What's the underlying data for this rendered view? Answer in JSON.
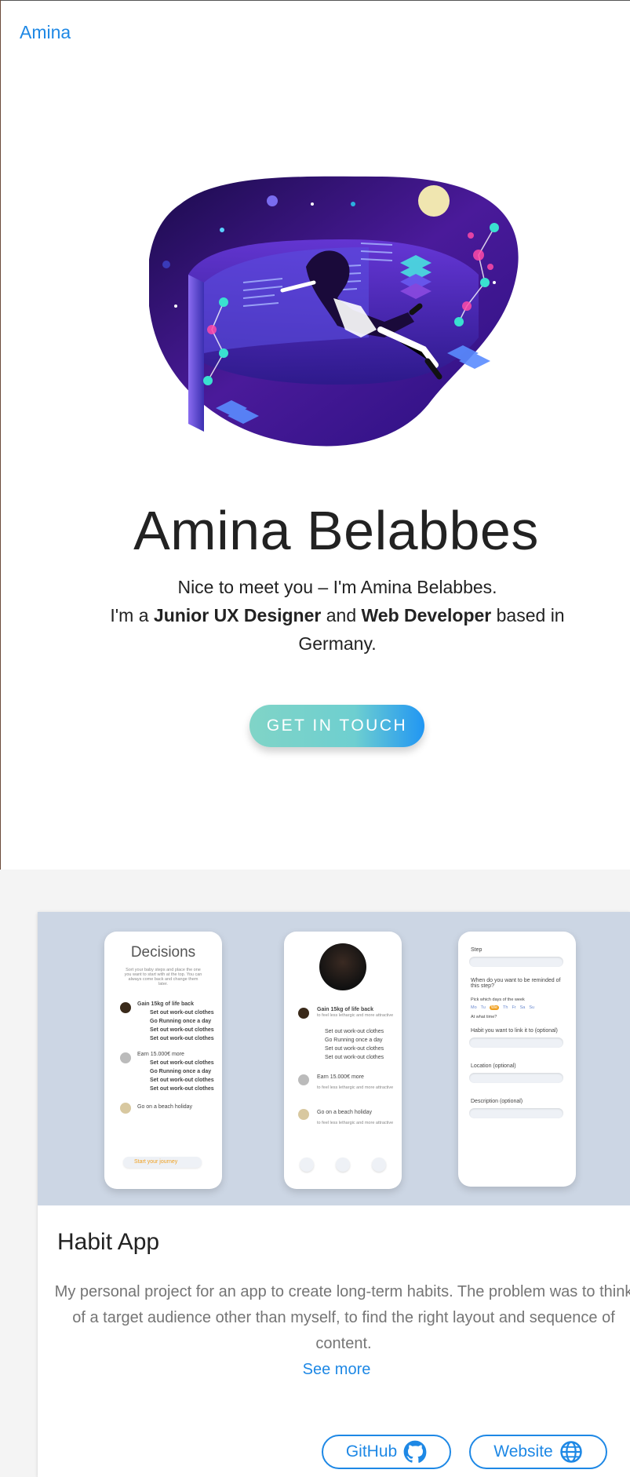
{
  "nav": {
    "brand": "Amina"
  },
  "hero": {
    "name": "Amina Belabbes",
    "intro_line1": "Nice to meet you – I'm Amina Belabbes.",
    "intro_prefix": "I'm a ",
    "role1": "Junior UX Designer",
    "intro_and": " and ",
    "role2": "Web Developer",
    "intro_suffix": " based in Germany.",
    "cta_label": "GET IN TOUCH"
  },
  "project": {
    "title": "Habit App",
    "description": "My personal project for an app to create long-term habits. The problem was to think of a target audience other than myself, to find the right layout and sequence of content.",
    "see_more": "See more",
    "github_label": "GitHub",
    "website_label": "Website",
    "mockups": {
      "screen1": {
        "title": "Decisions",
        "subtitle": "Sort your baby steps and place the one you want to start with at the top. You can always come back and change them later.",
        "goal1": "Gain 15kg of life back",
        "steps": [
          "Set out work-out clothes",
          "Go Running once a day",
          "Set out work-out clothes",
          "Set out work-out clothes"
        ],
        "goal2": "Earn 15.000€ more",
        "goal3": "Go on a beach holiday",
        "button": "Start your journey"
      },
      "screen2": {
        "goal1": "Gain 15kg of life back",
        "goal1_sub": "to feel less lethargic and more attractive",
        "steps": [
          "Set out work-out clothes",
          "Go Running once a day",
          "Set out work-out clothes",
          "Set out work-out clothes"
        ],
        "goal2": "Earn 15.000€ more",
        "goal2_sub": "to feel less lethargic and more attractive",
        "goal3": "Go on a beach holiday",
        "goal3_sub": "to feel less lethargic and more attractive"
      },
      "screen3": {
        "step_label": "Step",
        "remind_label": "When do you want to be reminded of this step?",
        "days_label": "Pick which days of the week",
        "days": [
          "Mo",
          "Tu",
          "We",
          "Th",
          "Fr",
          "Sa",
          "Su"
        ],
        "time_label": "At what time?",
        "habit_label": "Habit you want to link it to (optional)",
        "location_label": "Location (optional)",
        "description_label": "Description (optional)"
      }
    }
  }
}
